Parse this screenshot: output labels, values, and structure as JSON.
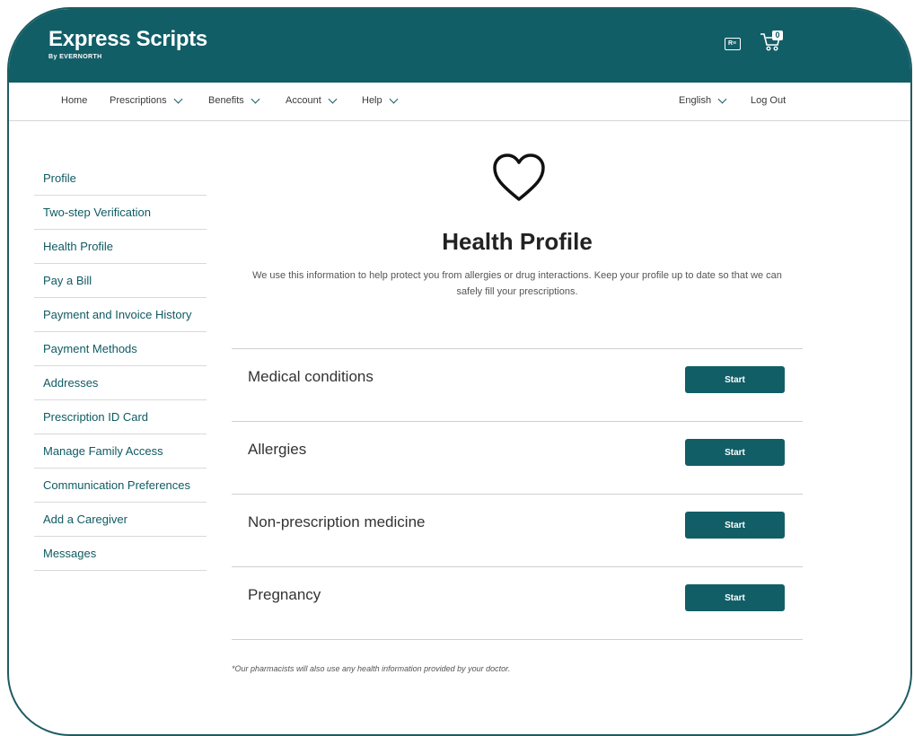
{
  "brand": {
    "name": "Express Scripts",
    "sub": "By EVERNORTH"
  },
  "header": {
    "cart_count": "0"
  },
  "nav": {
    "items": [
      {
        "label": "Home"
      },
      {
        "label": "Prescriptions"
      },
      {
        "label": "Benefits"
      },
      {
        "label": "Account"
      },
      {
        "label": "Help"
      }
    ],
    "language": "English",
    "logout": "Log Out"
  },
  "sidebar": {
    "items": [
      {
        "label": "Profile"
      },
      {
        "label": "Two-step Verification"
      },
      {
        "label": "Health Profile"
      },
      {
        "label": "Pay a Bill"
      },
      {
        "label": "Payment and Invoice History"
      },
      {
        "label": "Payment Methods"
      },
      {
        "label": "Addresses"
      },
      {
        "label": "Prescription ID Card"
      },
      {
        "label": "Manage Family Access"
      },
      {
        "label": "Communication Preferences"
      },
      {
        "label": "Add a Caregiver"
      },
      {
        "label": "Messages"
      }
    ]
  },
  "main": {
    "title": "Health Profile",
    "description": "We use this information to help protect you from allergies or drug interactions. Keep your profile up to date so that we can safely fill your prescriptions.",
    "sections": [
      {
        "label": "Medical conditions",
        "button": "Start"
      },
      {
        "label": "Allergies",
        "button": "Start"
      },
      {
        "label": "Non-prescription medicine",
        "button": "Start"
      },
      {
        "label": "Pregnancy",
        "button": "Start"
      }
    ],
    "footnote": "*Our pharmacists will also use any health information provided by your doctor."
  },
  "colors": {
    "brand": "#115e67",
    "link": "#0f5a62"
  }
}
